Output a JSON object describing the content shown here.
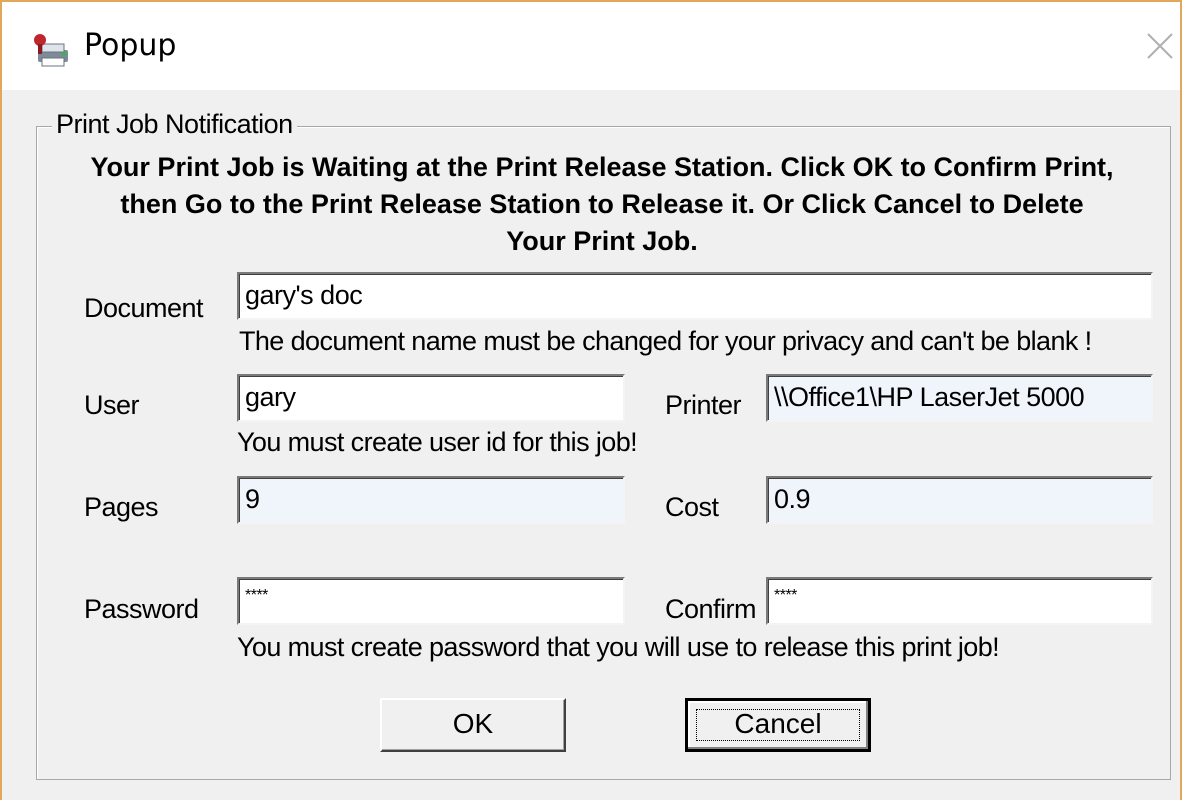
{
  "window": {
    "title": "Popup",
    "app_icon": "print-job-icon",
    "close_icon": "close-icon"
  },
  "group": {
    "legend": "Print Job Notification",
    "message_lines": [
      "Your Print Job is Waiting at the Print Release Station. Click OK to Confirm Print,",
      "then Go to the Print Release Station to Release it. Or Click Cancel to Delete",
      "Your Print Job."
    ]
  },
  "form": {
    "document_label": "Document",
    "document_value": "gary's doc",
    "document_hint": "The document name must be changed for your privacy and can't be blank !",
    "user_label": "User",
    "user_value": "gary",
    "user_hint": "You must create user id for this job!",
    "printer_label": "Printer",
    "printer_value": "\\\\Office1\\HP LaserJet 5000",
    "pages_label": "Pages",
    "pages_value": "9",
    "cost_label": "Cost",
    "cost_value": "0.9",
    "password_label": "Password",
    "password_value": "****",
    "confirm_label": "Confirm",
    "confirm_value": "****",
    "password_hint": "You must create password that you will use to release this print job!"
  },
  "buttons": {
    "ok_label": "OK",
    "cancel_label": "Cancel"
  }
}
